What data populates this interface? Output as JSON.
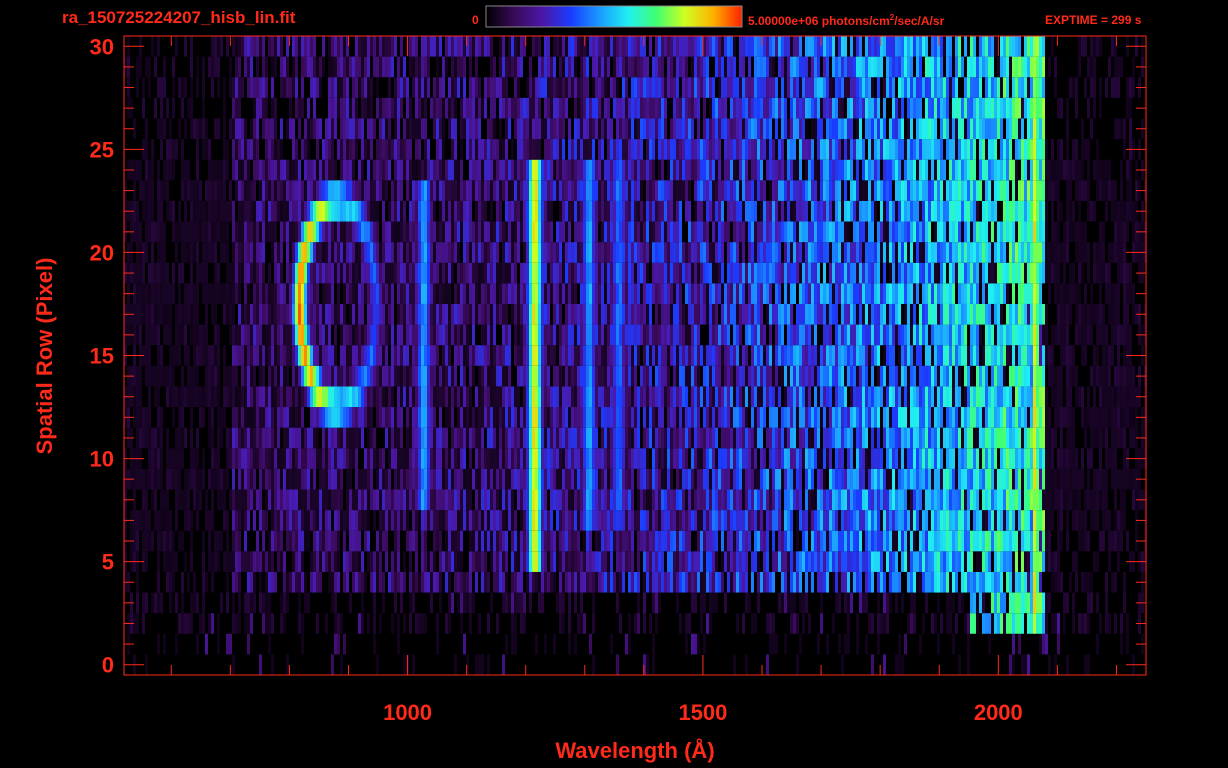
{
  "header": {
    "file_title": "ra_150725224207_hisb_lin.fit",
    "colorbar_min_label": "0",
    "colorbar_max_value": "5.00000e+06",
    "colorbar_units_pre": "photons/cm",
    "colorbar_units_sup": "2",
    "colorbar_units_post": "/sec/A/sr",
    "exptime_label": "EXPTIME = 299 s"
  },
  "colors": {
    "background": "#000000",
    "axis_and_text": "#ff2a1a",
    "colormap": [
      "#000000",
      "#3a0a5a",
      "#4a18a8",
      "#1a3cff",
      "#1a9cff",
      "#20f0f0",
      "#40ff70",
      "#d0ff20",
      "#ffb000",
      "#ff2000"
    ]
  },
  "chart_data": {
    "type": "heatmap",
    "title": "ra_150725224207_hisb_lin.fit",
    "xlabel": "Wavelength (Å)",
    "ylabel": "Spatial Row (Pixel)",
    "xlim": [
      520,
      2250
    ],
    "ylim": [
      -0.5,
      30.5
    ],
    "xticks": [
      1000,
      1500,
      2000
    ],
    "xtick_labels": [
      "1000",
      "1500",
      "2000"
    ],
    "yticks": [
      0,
      5,
      10,
      15,
      20,
      25,
      30
    ],
    "ytick_labels": [
      "0",
      "5",
      "10",
      "15",
      "20",
      "25",
      "30"
    ],
    "colorbar": {
      "min": 0,
      "max": 5000000,
      "units": "photons/cm^2/sec/A/sr",
      "position": "top"
    },
    "grid": false,
    "features": [
      {
        "shape": "ring",
        "center_wavelength": 880,
        "center_row": 17.5,
        "x_radius": 65,
        "y_radius": 5,
        "peak_side": "left",
        "peak_level": 0.95
      },
      {
        "shape": "vertical_line",
        "wavelength": 1213,
        "row_range": [
          5,
          24
        ],
        "level": 0.82
      },
      {
        "shape": "vertical_line",
        "wavelength": 1025,
        "row_range": [
          8,
          23
        ],
        "level": 0.45
      },
      {
        "shape": "vertical_line",
        "wavelength": 1305,
        "row_range": [
          7,
          24
        ],
        "level": 0.45
      },
      {
        "shape": "vertical_line",
        "wavelength": 1355,
        "row_range": [
          7,
          24
        ],
        "level": 0.38
      },
      {
        "shape": "edge_band",
        "wavelength": 2060,
        "row_range": [
          2,
          30
        ],
        "level": 0.8
      }
    ]
  }
}
